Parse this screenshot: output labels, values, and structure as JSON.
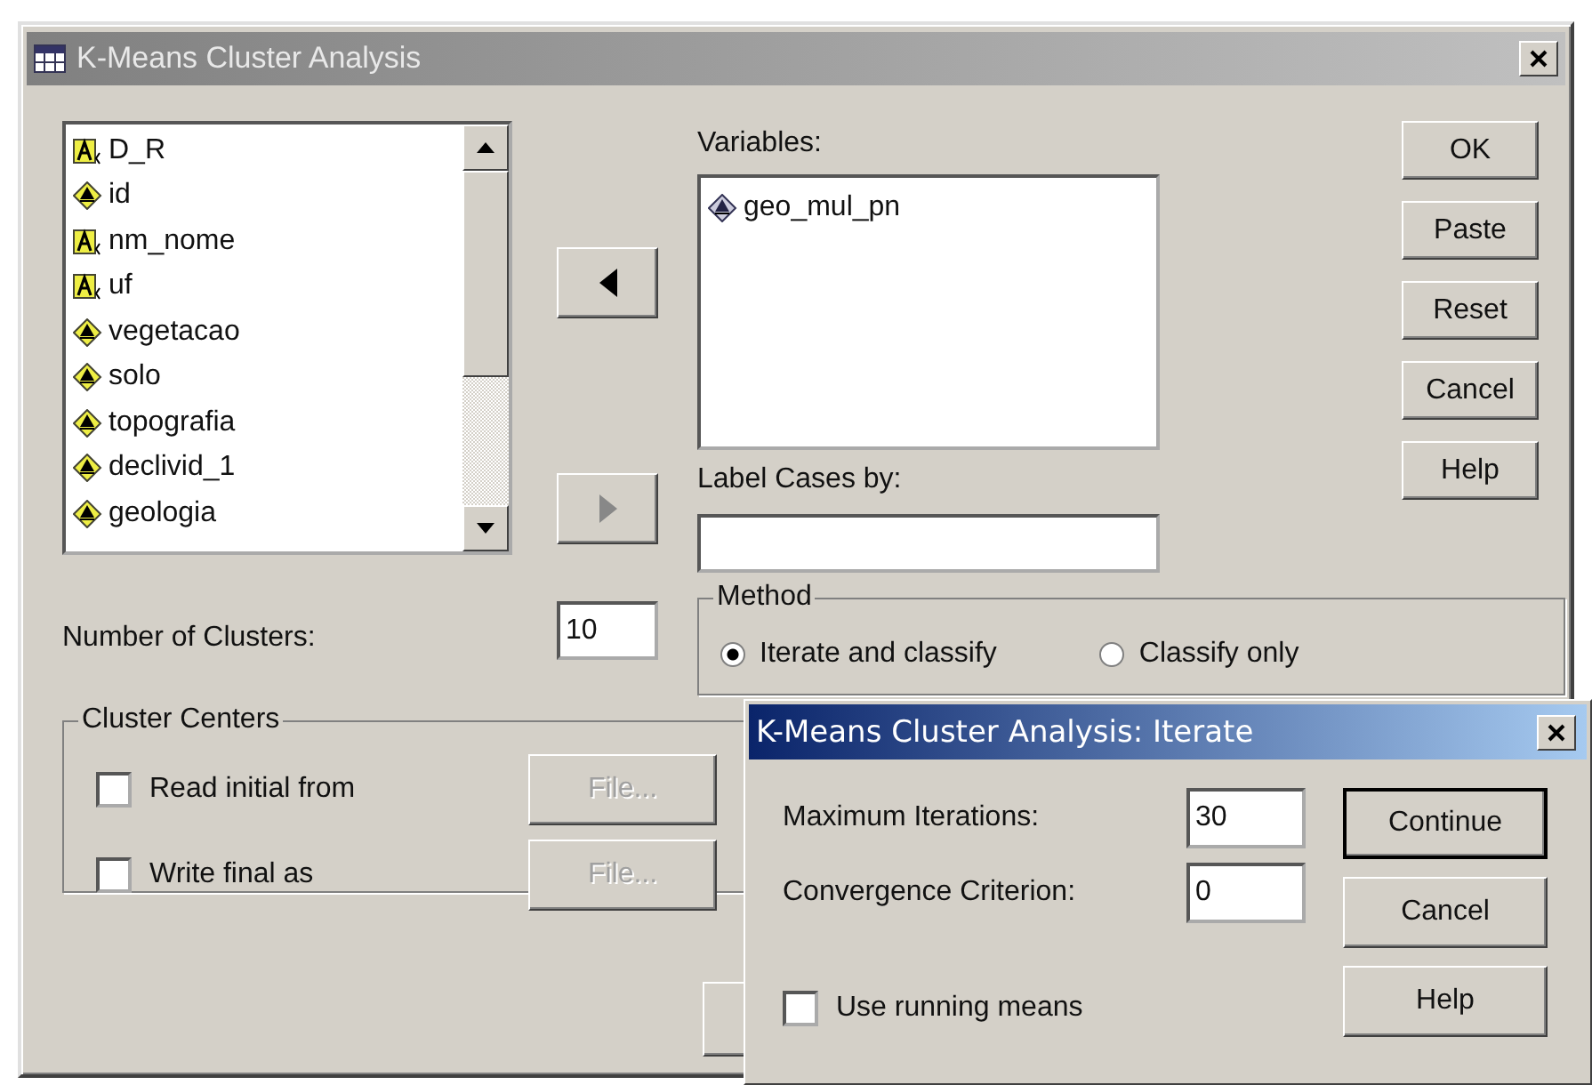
{
  "window": {
    "title": "K-Means Cluster Analysis"
  },
  "source_list": {
    "items": [
      {
        "name": "D_R",
        "kind": "string"
      },
      {
        "name": "id",
        "kind": "scale"
      },
      {
        "name": "nm_nome",
        "kind": "string"
      },
      {
        "name": "uf",
        "kind": "string"
      },
      {
        "name": "vegetacao",
        "kind": "scale"
      },
      {
        "name": "solo",
        "kind": "scale"
      },
      {
        "name": "topografia",
        "kind": "scale"
      },
      {
        "name": "declivid_1",
        "kind": "scale"
      },
      {
        "name": "geologia",
        "kind": "scale"
      }
    ]
  },
  "move_buttons": [
    {
      "kind": "left",
      "disabled": false
    },
    {
      "kind": "right",
      "disabled": true
    }
  ],
  "variables": {
    "label": "Variables:",
    "items": [
      {
        "name": "geo_mul_pn",
        "kind": "scale"
      }
    ]
  },
  "label_cases": {
    "label": "Label Cases by:"
  },
  "buttons": [
    "OK",
    "Paste",
    "Reset",
    "Cancel",
    "Help"
  ],
  "clusters": {
    "label": "Number of Clusters:",
    "value": "10"
  },
  "method": {
    "title": "Method",
    "options": [
      {
        "label": "Iterate and classify",
        "selected": true
      },
      {
        "label": "Classify only",
        "selected": false
      }
    ]
  },
  "cluster_centers": {
    "title": "Cluster Centers",
    "rows": [
      {
        "label": "Read initial from",
        "checked": false,
        "button": "File...",
        "disabled": true
      },
      {
        "label": "Write final as",
        "checked": false,
        "button": "File...",
        "disabled": true
      }
    ]
  },
  "iterate_dialog": {
    "title": "K-Means Cluster Analysis: Iterate",
    "fields": [
      {
        "label": "Maximum Iterations:",
        "value": "30"
      },
      {
        "label": "Convergence Criterion:",
        "value": "0"
      }
    ],
    "checkbox": {
      "label": "Use running means",
      "checked": false
    },
    "buttons": [
      "Continue",
      "Cancel",
      "Help"
    ]
  }
}
